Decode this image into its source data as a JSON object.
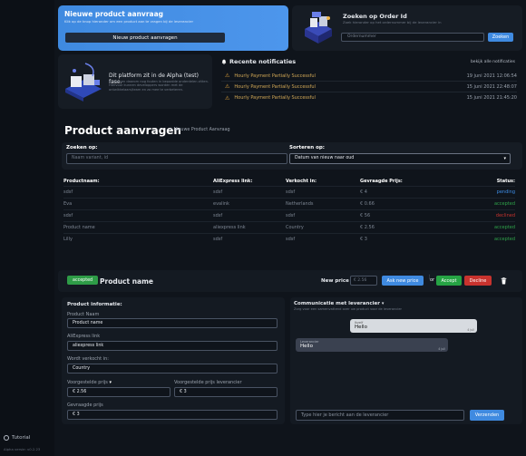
{
  "sidebar": {
    "tutorial_label": "Tutorial",
    "version": "Alpha versie: v0.2.23"
  },
  "request_card": {
    "title": "Nieuwe product aanvraag",
    "subtitle": "Klik op de knop hieronder om een product aan te vragen bij de leverancier",
    "button": "Nieuw product aanvragen"
  },
  "order_card": {
    "title": "Zoeken op Order Id",
    "subtitle": "Zoek hieronder op het ordernummer bij de leverancier in",
    "placeholder": "Ordernummer",
    "button": "Zoeken"
  },
  "alpha_card": {
    "title": "Dit platform zit in de Alpha (test) fase.",
    "subtitle": "Er kunnen daarom nog fouten in bepaalde onderdelen zitten. Hiervoor kunnen developpers worden met de ontwikkelaars/team en zo mee te verbeteren."
  },
  "notifications": {
    "title": "Recente notificaties",
    "view_all": "bekijk alle notificaties",
    "items": [
      {
        "text": "Hourly Payment Partially Successful",
        "time": "19 juni 2021 12:06:54"
      },
      {
        "text": "Hourly Payment Partially Successful",
        "time": "15 juni 2021 22:48:07"
      },
      {
        "text": "Hourly Payment Partially Successful",
        "time": "15 juni 2021 21:45:20"
      }
    ]
  },
  "products": {
    "title": "Product aanvragen",
    "new_link": "+ Nieuwe Product Aanvraag",
    "search_label": "Zoeken op:",
    "search_placeholder": "Naam variant, id",
    "sort_label": "Sorteren op:",
    "sort_value": "Datum van nieuw naar oud",
    "columns": [
      "Productnaam:",
      "AliExpress link:",
      "Verkocht in:",
      "Gevraagde Prijs:",
      "Status:"
    ],
    "rows": [
      {
        "name": "sdsf",
        "link": "sdsf",
        "country": "sdsf",
        "price": "€ 4",
        "status": "pending"
      },
      {
        "name": "Eva",
        "link": "evalink",
        "country": "Netherlands",
        "price": "€ 0.66",
        "status": "accepted"
      },
      {
        "name": "sdsf",
        "link": "sdsf",
        "country": "sdsf",
        "price": "€ 56",
        "status": "declined"
      },
      {
        "name": "Product name",
        "link": "aliexpress link",
        "country": "Country",
        "price": "€ 2.56",
        "status": "accepted"
      },
      {
        "name": "Lilly",
        "link": "sdsf",
        "country": "sdsf",
        "price": "€ 3",
        "status": "accepted"
      }
    ]
  },
  "detail": {
    "status_badge": "accepted",
    "product_name": "Product name",
    "new_price_label": "New price",
    "new_price_placeholder": "€ 2.56",
    "ask_button": "Ask new price",
    "or_label": "or",
    "accept_button": "Accept",
    "decline_button": "Decline"
  },
  "info": {
    "title": "Product informatie:",
    "name_label": "Product Naam",
    "name_value": "Product name",
    "link_label": "AliExpress link",
    "link_value": "aliexpress link",
    "country_label": "Wordt verkocht in:",
    "country_value": "Country",
    "suggested_label": "Voorgestelde prijs",
    "suggested_value": "€ 2.56",
    "supplier_label": "Voorgestelde prijs leverancier",
    "supplier_value": "€ 3",
    "asked_label": "Gevraagde prijs",
    "asked_value": "€ 3"
  },
  "chat": {
    "title": "Communicatie met leverancier",
    "subtitle": "Zorg voor een samenvattend over uw product voor de leverancier",
    "messages": [
      {
        "from": "Ikzelf",
        "text": "Hello",
        "time": "4 juli"
      },
      {
        "from": "Leverancier",
        "text": "Hello",
        "time": "4 juli"
      }
    ],
    "placeholder": "Type hier je bericht aan de leverancier",
    "send_button": "Verzenden"
  }
}
